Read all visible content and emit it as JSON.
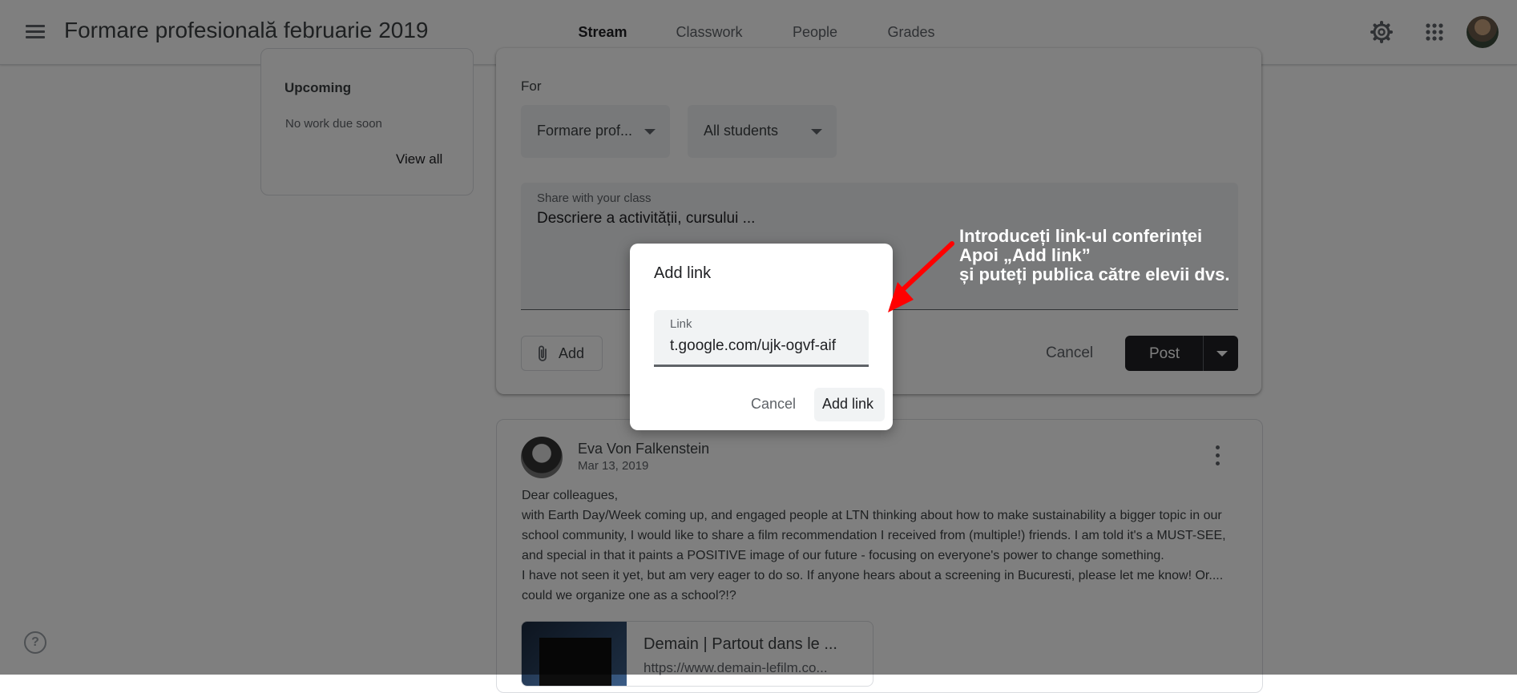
{
  "header": {
    "class_title": "Formare profesională februarie 2019",
    "tabs": [
      {
        "label": "Stream",
        "active": true
      },
      {
        "label": "Classwork",
        "active": false
      },
      {
        "label": "People",
        "active": false
      },
      {
        "label": "Grades",
        "active": false
      }
    ],
    "icons": [
      "menu-icon",
      "gear-icon",
      "apps-grid-icon",
      "avatar"
    ]
  },
  "upcoming": {
    "title": "Upcoming",
    "empty_text": "No work due soon",
    "view_all": "View all"
  },
  "compose": {
    "for_label": "For",
    "class_select": "Formare prof...",
    "audience_select": "All students",
    "share_label": "Share with your class",
    "share_value": "Descriere a activității, cursului ...",
    "add_label": "Add",
    "cancel_label": "Cancel",
    "post_label": "Post"
  },
  "post": {
    "author": "Eva Von Falkenstein",
    "date": "Mar 13, 2019",
    "lines": [
      "Dear colleagues,",
      "with Earth Day/Week coming up, and engaged people at LTN thinking about how to make sustainability a bigger topic in our",
      "school community, I would like to share a film recommendation I received from (multiple!) friends. I am told it's a MUST-SEE,",
      "and special in that it paints a POSITIVE image of our future - focusing on everyone's power to change something.",
      "I have not seen it yet, but am very eager to do so. If anyone hears about a screening in Bucuresti, please let me know! Or....",
      "could we organize one as a school?!?"
    ],
    "link_title": "Demain | Partout dans le ...",
    "link_url": "https://www.demain-lefilm.co..."
  },
  "dialog": {
    "title": "Add link",
    "field_label": "Link",
    "field_value": "t.google.com/ujk-ogvf-aif",
    "cancel_label": "Cancel",
    "add_label": "Add link"
  },
  "annotation": {
    "lines": [
      "Introduceți link-ul conferinței",
      "Apoi „Add link”",
      "și puteți publica către elevii dvs."
    ],
    "arrow_color": "#ff0000"
  },
  "help_icon": "?"
}
